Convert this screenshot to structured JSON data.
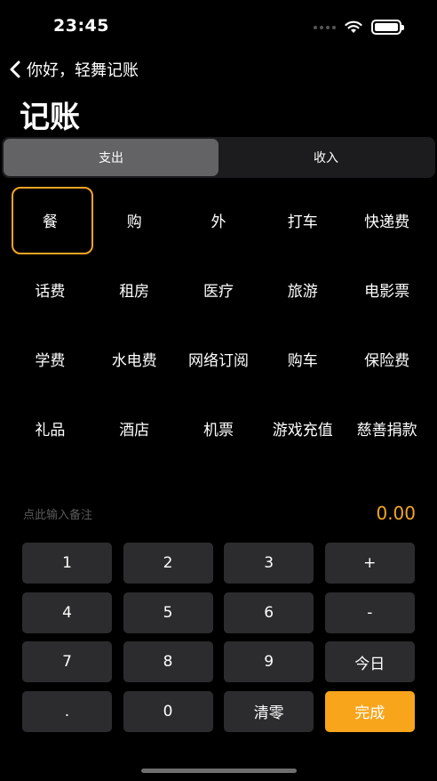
{
  "status_bar": {
    "time": "23:45"
  },
  "nav": {
    "back_label": "你好，轻舞记账"
  },
  "page": {
    "title": "记账"
  },
  "segment": {
    "items": [
      "支出",
      "收入"
    ]
  },
  "categories": [
    [
      "餐",
      "购",
      "外",
      "打车",
      "快递费"
    ],
    [
      "话费",
      "租房",
      "医疗",
      "旅游",
      "电影票"
    ],
    [
      "学费",
      "水电费",
      "网络订阅",
      "购车",
      "保险费"
    ],
    [
      "礼品",
      "酒店",
      "机票",
      "游戏充值",
      "慈善捐款"
    ]
  ],
  "note": {
    "placeholder": "点此输入备注"
  },
  "amount": "0.00",
  "keypad": [
    [
      "1",
      "2",
      "3",
      "+"
    ],
    [
      "4",
      "5",
      "6",
      "-"
    ],
    [
      "7",
      "8",
      "9",
      "今日"
    ],
    [
      ".",
      "0",
      "清零",
      "完成"
    ]
  ],
  "colors": {
    "accent": "#f8a51c",
    "background": "#000000",
    "key": "#2c2c2e"
  }
}
